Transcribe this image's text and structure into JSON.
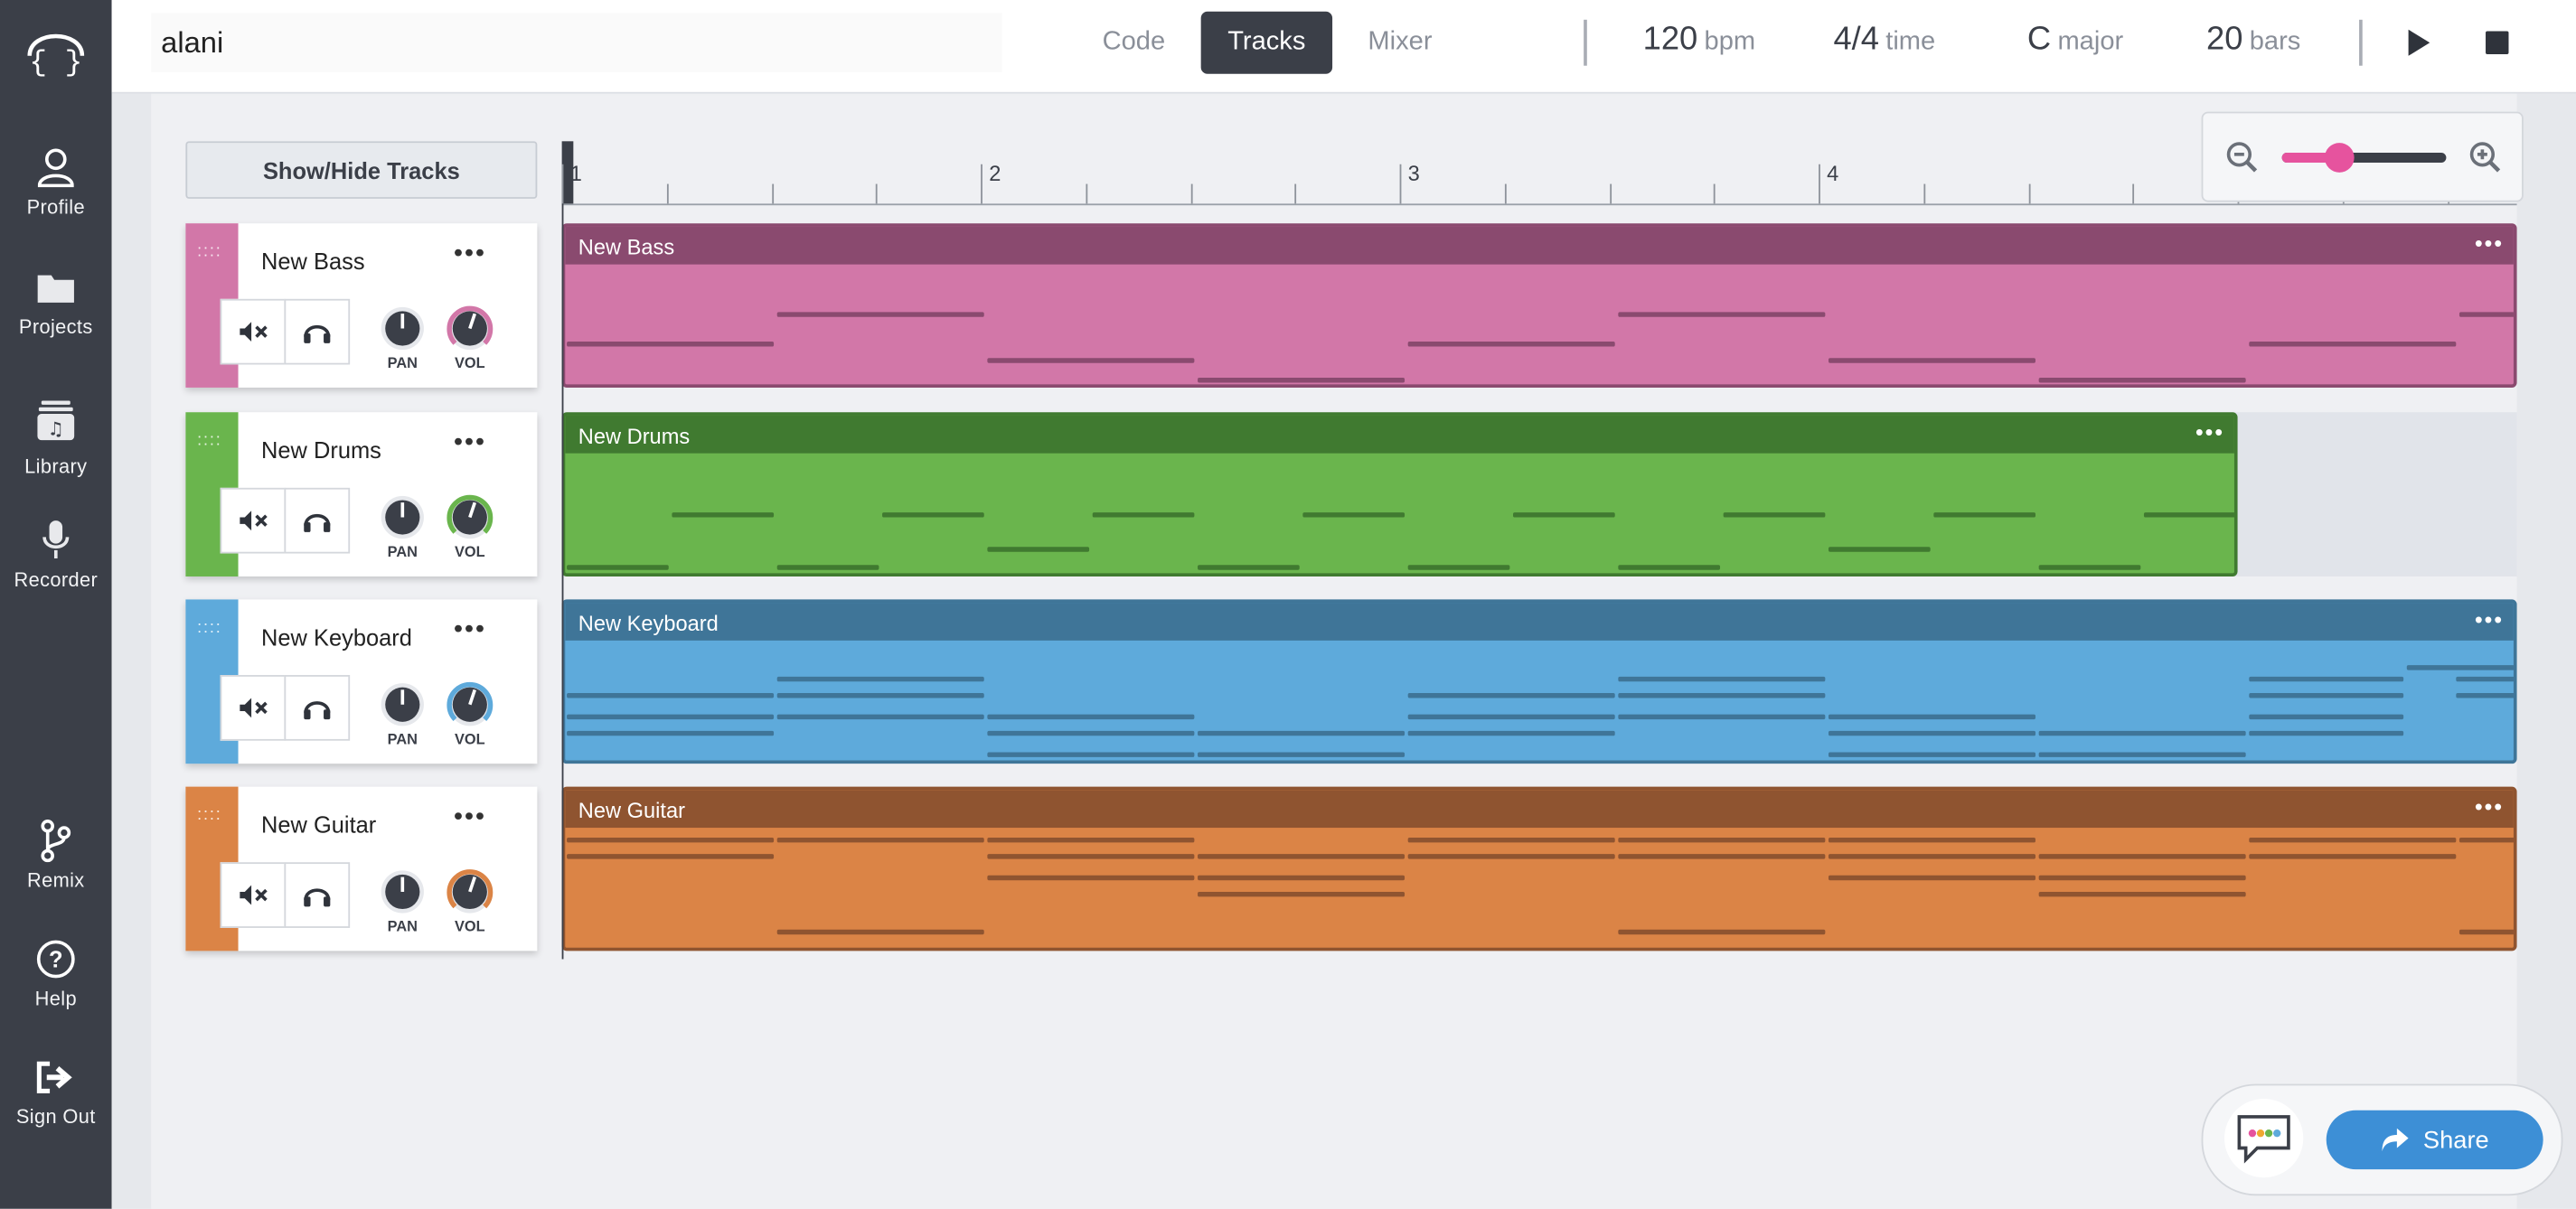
{
  "sidebar": {
    "items": [
      {
        "label": "Profile",
        "icon": "user-icon"
      },
      {
        "label": "Projects",
        "icon": "folder-icon"
      },
      {
        "label": "Library",
        "icon": "library-icon"
      },
      {
        "label": "Recorder",
        "icon": "microphone-icon"
      },
      {
        "label": "Remix",
        "icon": "branch-icon"
      },
      {
        "label": "Help",
        "icon": "help-icon"
      },
      {
        "label": "Sign Out",
        "icon": "sign-out-icon"
      }
    ]
  },
  "header": {
    "project_name": "alani",
    "tabs": [
      {
        "label": "Code",
        "active": false
      },
      {
        "label": "Tracks",
        "active": true
      },
      {
        "label": "Mixer",
        "active": false
      }
    ],
    "tempo": {
      "value": "120",
      "unit": "bpm"
    },
    "time_signature": {
      "value": "4/4",
      "unit": "time"
    },
    "key": {
      "value": "C",
      "unit": "major"
    },
    "length": {
      "value": "20",
      "unit": "bars"
    }
  },
  "tracks_panel": {
    "show_hide_label": "Show/Hide Tracks",
    "pan_label": "PAN",
    "vol_label": "VOL"
  },
  "ruler": {
    "bar_numbers": [
      "1",
      "2",
      "3",
      "4"
    ]
  },
  "zoom": {
    "level": 0.35
  },
  "colors": {
    "bass": "#d277a8",
    "bass_dark": "#8a4a6f",
    "drums": "#6ab54d",
    "drums_dark": "#407a30",
    "keyboard": "#5eaadb",
    "keyboard_dark": "#3f7598",
    "guitar": "#db8446",
    "guitar_dark": "#8f5430",
    "accent": "#e6539e",
    "share": "#3d8fd6",
    "sidebar": "#3b3f48"
  },
  "tracks": [
    {
      "name": "New Bass",
      "color_key": "bass"
    },
    {
      "name": "New Drums",
      "color_key": "drums"
    },
    {
      "name": "New Keyboard",
      "color_key": "keyboard"
    },
    {
      "name": "New Guitar",
      "color_key": "guitar"
    }
  ],
  "share_label": "Share"
}
